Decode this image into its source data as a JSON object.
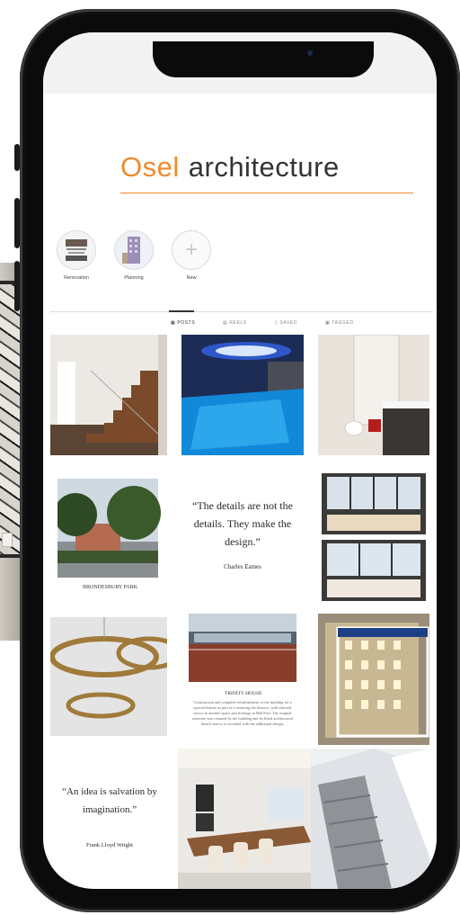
{
  "brand": {
    "name_accent": "Osel",
    "name_rest": "architecture"
  },
  "highlights": [
    {
      "label": "Renovation",
      "icon": "renovation-thumbnail"
    },
    {
      "label": "Planning",
      "icon": "planning-thumbnail"
    },
    {
      "label": "New",
      "icon": "plus-icon"
    }
  ],
  "tabs": [
    {
      "label": "POSTS",
      "icon": "grid-icon",
      "active": true
    },
    {
      "label": "REELS",
      "icon": "reels-icon",
      "active": false
    },
    {
      "label": "SAVED",
      "icon": "bookmark-icon",
      "active": false
    },
    {
      "label": "TAGGED",
      "icon": "tag-icon",
      "active": false
    }
  ],
  "posts": {
    "caption_brondesbury": "BRONDESBURY PARK",
    "quote1": {
      "text": "“The details are not the details. They make the design.”",
      "author": "Charles Eames"
    },
    "trinity": {
      "title": "TRINITY HOUSE",
      "body": "Construction and complete refurbishment of the building for a special feature as part of a restoring the historic, with restored stucco to another space and frontage at Mid Post. The original structure was retained by the building and its lifted architectural details and so is recorded with the additional design."
    },
    "quote2": {
      "text": "“An idea is salvation by imagination.”",
      "author": "Frank Lloyd Wright"
    }
  },
  "colors": {
    "accent": "#ee8a2f",
    "text": "#333333"
  }
}
